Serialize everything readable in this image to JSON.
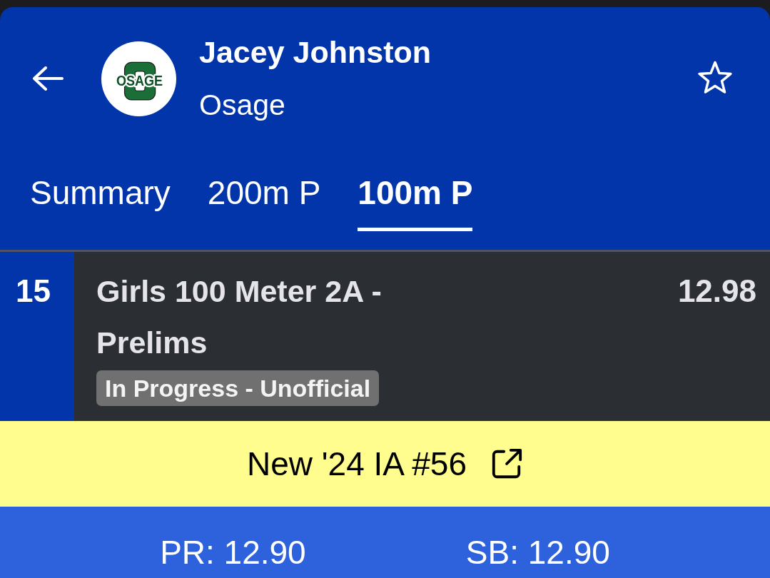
{
  "header": {
    "athlete_name": "Jacey Johnston",
    "team": "Osage",
    "logo_text": "OSAGE",
    "favorite": false
  },
  "tabs": [
    {
      "label": "Summary",
      "selected": false
    },
    {
      "label": "200m P",
      "selected": false
    },
    {
      "label": "100m P",
      "selected": true
    }
  ],
  "event": {
    "number": "15",
    "title": "Girls 100 Meter 2A - Prelims",
    "mark": "12.98",
    "status": "In Progress - Unofficial"
  },
  "ranking_banner": {
    "text": "New '24 IA #56"
  },
  "bests": [
    {
      "text": "PR: 12.90"
    },
    {
      "text": "SB: 12.90"
    }
  ]
}
